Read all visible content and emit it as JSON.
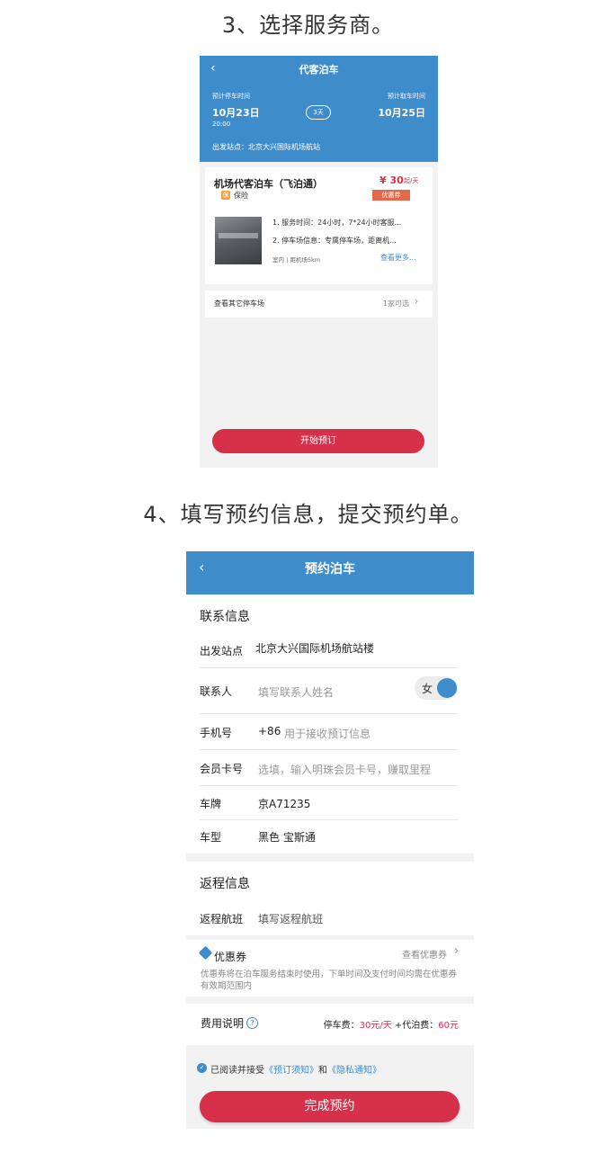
{
  "steps": {
    "step3": "3、选择服务商。",
    "step4": "4、填写预约信息，提交预约单。"
  },
  "screen1": {
    "back": "‹",
    "title": "代客泊车",
    "park_time_label": "预计停车时间",
    "park_date": "10月23日",
    "park_time": "20:00",
    "days": "3天",
    "pickup_time_label": "预计取车时间",
    "pickup_date": "10月25日",
    "station": "出发站点：北京大兴国际机场航站",
    "card": {
      "name": "机场代客泊车（飞泊通）",
      "insurance_icon": "保",
      "insurance": "保险",
      "price": "¥ 30",
      "price_unit": "起/天",
      "coupon": "优惠券",
      "line1": "1. 服务时间：24小时，7*24小时客服...",
      "line2": "2. 停车场信息：专属停车场，距离机...",
      "meta": "室内 | 距机场5km",
      "more": "查看更多..."
    },
    "other_lots_label": "查看其它停车场",
    "other_lots_count": "1家可选",
    "start_button": "开始预订"
  },
  "screen2": {
    "back": "‹",
    "title": "预约泊车",
    "contact_section": "联系信息",
    "station_label": "出发站点",
    "station_value": "北京大兴国际机场航站楼",
    "contact_label": "联系人",
    "contact_placeholder": "填写联系人姓名",
    "gender": "女",
    "phone_label": "手机号",
    "phone_prefix": "+86",
    "phone_placeholder": "用于接收预订信息",
    "member_label": "会员卡号",
    "member_placeholder": "选填，输入明珠会员卡号，赚取里程",
    "plate_label": "车牌",
    "plate_value": "京A71235",
    "model_label": "车型",
    "model_value": "黑色 宝斯通",
    "return_section": "返程信息",
    "return_flight_label": "返程航班",
    "return_flight_placeholder": "填写返程航班",
    "coupon_title": "优惠券",
    "coupon_link": "查看优惠券",
    "coupon_desc": "优惠券将在泊车服务结束时使用，下单时间及支付时间均需在优惠券有效期范围内",
    "fee_label": "费用说明",
    "fee_help": "?",
    "fee_park_label": "停车费：",
    "fee_park_value": "30元/天",
    "fee_valet_label": " +代泊费：",
    "fee_valet_value": "60元",
    "agree_prefix": "已阅读并接受",
    "agree_link1": "《预订须知》",
    "agree_and": "和",
    "agree_link2": "《隐私通知》",
    "submit_button": "完成预约"
  },
  "colors": {
    "primary_blue": "#3f8ccb",
    "accent_red": "#d6304a"
  }
}
